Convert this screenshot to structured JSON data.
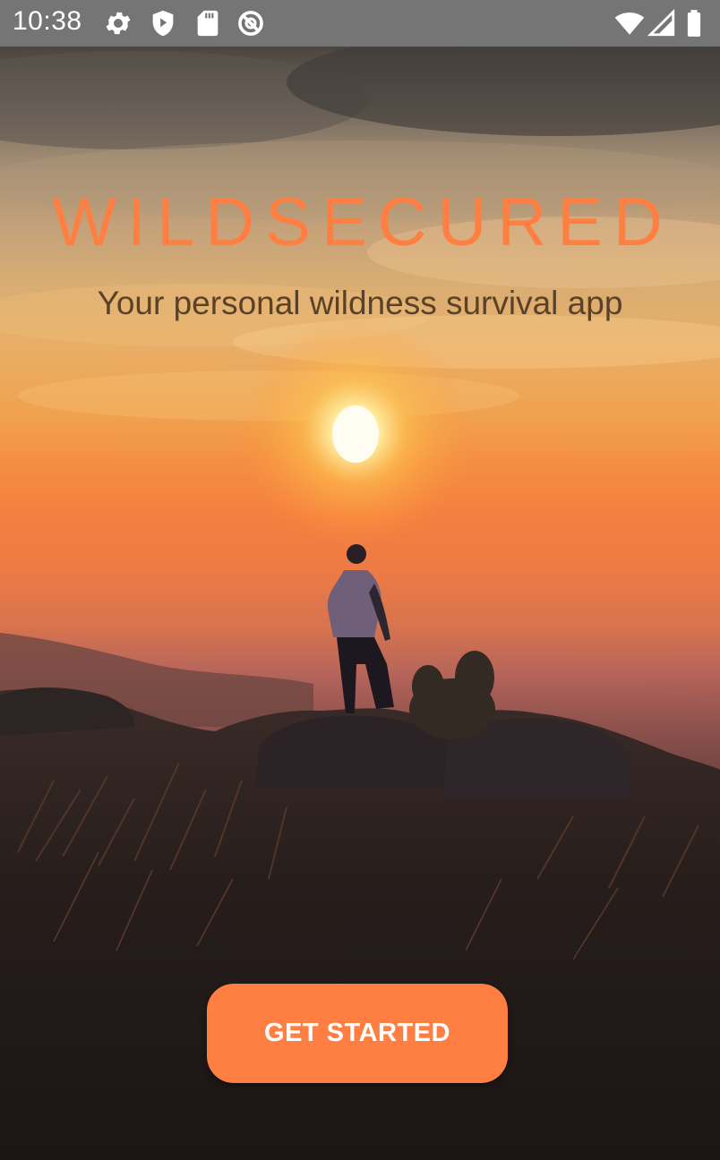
{
  "status_bar": {
    "time": "10:38",
    "left_icons": [
      "gear-icon",
      "shield-play-icon",
      "sd-card-icon",
      "no-disturb-icon"
    ],
    "right_icons": [
      "wifi-icon",
      "cell-signal-icon",
      "battery-icon"
    ]
  },
  "hero": {
    "title": "WILDSECURED",
    "subtitle": "Your personal wildness survival app",
    "image": "sunset-hiker-photo"
  },
  "cta": {
    "label": "GET STARTED"
  },
  "colors": {
    "accent": "#ff7f43",
    "status_bar": "#757575",
    "subtitle": "#5a4127"
  }
}
